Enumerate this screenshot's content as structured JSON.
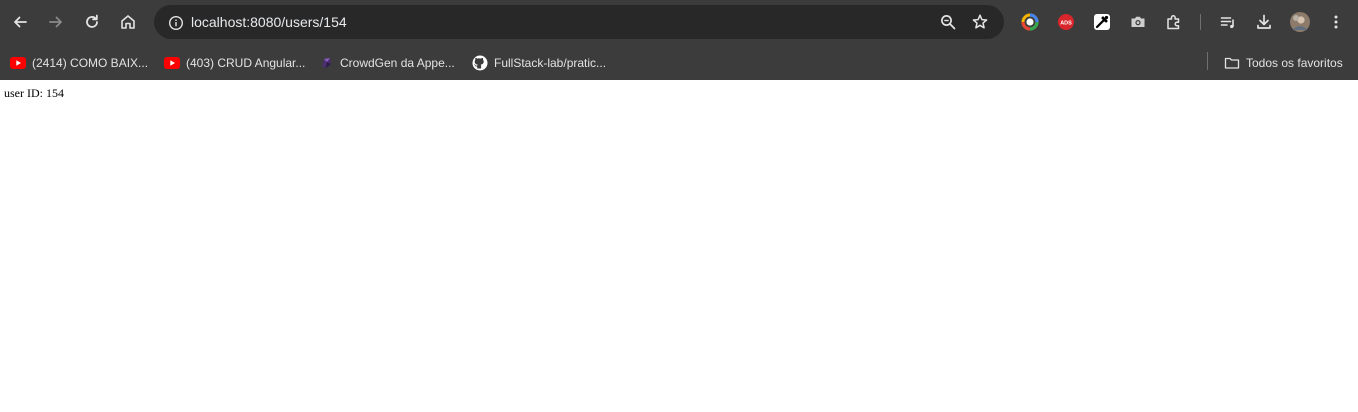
{
  "browser": {
    "url": "localhost:8080/users/154",
    "nav_icons": [
      "back-icon",
      "forward-icon",
      "reload-icon",
      "home-icon"
    ],
    "omnibox_icons": [
      "site-info-icon",
      "zoom-icon",
      "star-icon"
    ],
    "extension_icons": [
      "color-ring-extension-icon",
      "ads-blocker-extension-icon",
      "eyedropper-extension-icon",
      "camera-extension-icon",
      "extensions-puzzle-icon"
    ],
    "extension_ads_text": "ADS",
    "right_icons": [
      "reading-list-icon",
      "download-icon",
      "profile-avatar",
      "more-vert-icon"
    ]
  },
  "bookmarks": {
    "items": [
      {
        "label": "(2414) COMO BAIX...",
        "icon": "youtube-icon"
      },
      {
        "label": "(403) CRUD Angular...",
        "icon": "youtube-icon"
      },
      {
        "label": "CrowdGen da Appe...",
        "icon": "crowdgen-icon"
      },
      {
        "label": "FullStack-lab/pratic...",
        "icon": "github-icon"
      }
    ],
    "all_bookmarks": {
      "label": "Todos os favoritos",
      "icon": "folder-icon"
    }
  },
  "page": {
    "user_line": "user ID: 154"
  },
  "colors": {
    "chrome_background": "#3c3c3c",
    "omnibox_background": "#282828",
    "chrome_text": "#e3e3e3",
    "youtube_red": "#ff0000",
    "page_background": "#ffffff"
  }
}
